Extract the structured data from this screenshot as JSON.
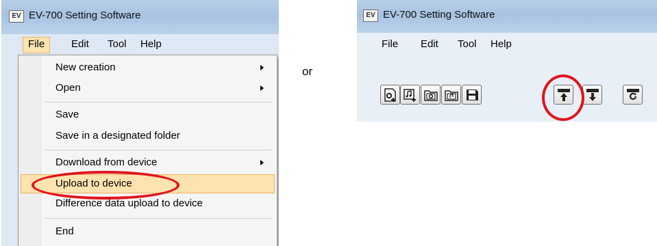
{
  "left_window": {
    "app_icon": "EV",
    "title": "EV-700 Setting Software",
    "menu": [
      "File",
      "Edit",
      "Tool",
      "Help"
    ],
    "file_menu": {
      "items": [
        {
          "label": "New creation",
          "submenu": true
        },
        {
          "label": "Open",
          "submenu": true
        },
        {
          "label": "Save",
          "submenu": false
        },
        {
          "label": "Save in a designated folder",
          "submenu": false
        },
        {
          "label": "Download from device",
          "submenu": true
        },
        {
          "label": "Upload to device",
          "submenu": false,
          "highlighted": true
        },
        {
          "label": "Difference data upload to device",
          "submenu": false
        },
        {
          "label": "End",
          "submenu": false
        }
      ]
    }
  },
  "separator_word": "or",
  "right_window": {
    "app_icon": "EV",
    "title": "EV-700 Setting Software",
    "menu": [
      "File",
      "Edit",
      "Tool",
      "Help"
    ],
    "toolbar_buttons": [
      "new-settings-icon",
      "new-music-icon",
      "open-settings-folder-icon",
      "open-music-folder-icon",
      "save-floppy-icon",
      "upload-to-device-icon",
      "download-from-device-icon",
      "sync-device-icon"
    ]
  },
  "colors": {
    "highlight_annotation": "#e2141b",
    "menu_hover": "#fde3b0",
    "titlebar": "#a7c2e2"
  }
}
